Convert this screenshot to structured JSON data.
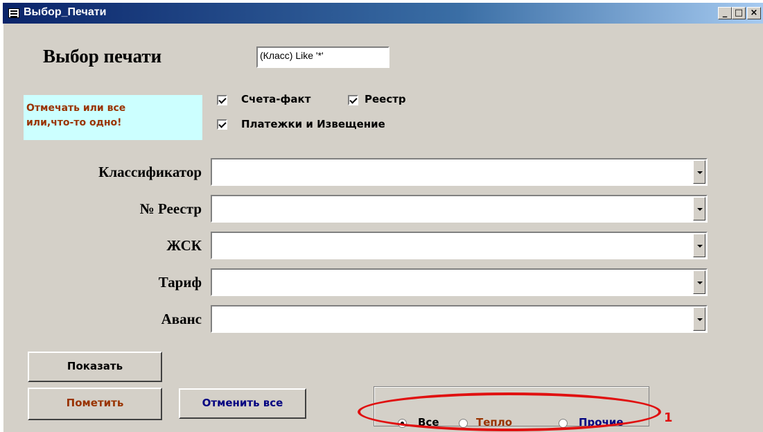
{
  "window": {
    "title": "Выбор_Печати",
    "controls": {
      "minimize": "_",
      "maximize": "□",
      "close": "×"
    }
  },
  "heading": "Выбор печати",
  "filter_value": "(Класс)  Like '*'",
  "note": {
    "line1": "Отмечать или все",
    "line2": "или,что-то одно!"
  },
  "checkboxes": [
    {
      "label": "Счета-факт",
      "checked": true
    },
    {
      "label": "Реестр",
      "checked": true
    },
    {
      "label": "Платежки и Извещение",
      "checked": true
    }
  ],
  "fields": [
    {
      "label": "Классификатор",
      "value": ""
    },
    {
      "label": "№ Реестр",
      "value": ""
    },
    {
      "label": "ЖСК",
      "value": ""
    },
    {
      "label": "Тариф",
      "value": ""
    },
    {
      "label": "Аванс",
      "value": ""
    }
  ],
  "buttons": {
    "show": "Показать",
    "mark": "Пометить",
    "cancel_all": "Отменить все"
  },
  "radio_group": {
    "selected": "Все",
    "options": [
      {
        "label": "Все",
        "color": "#000000"
      },
      {
        "label": "Тепло",
        "color": "#993300"
      },
      {
        "label": "Прочие",
        "color": "#000080"
      }
    ]
  },
  "annotation": {
    "number": "1",
    "color": "#e01010"
  },
  "colors": {
    "face": "#d4d0c8",
    "titlebar_start": "#0a246a",
    "note_bg": "#ccffff",
    "note_text": "#993300"
  }
}
